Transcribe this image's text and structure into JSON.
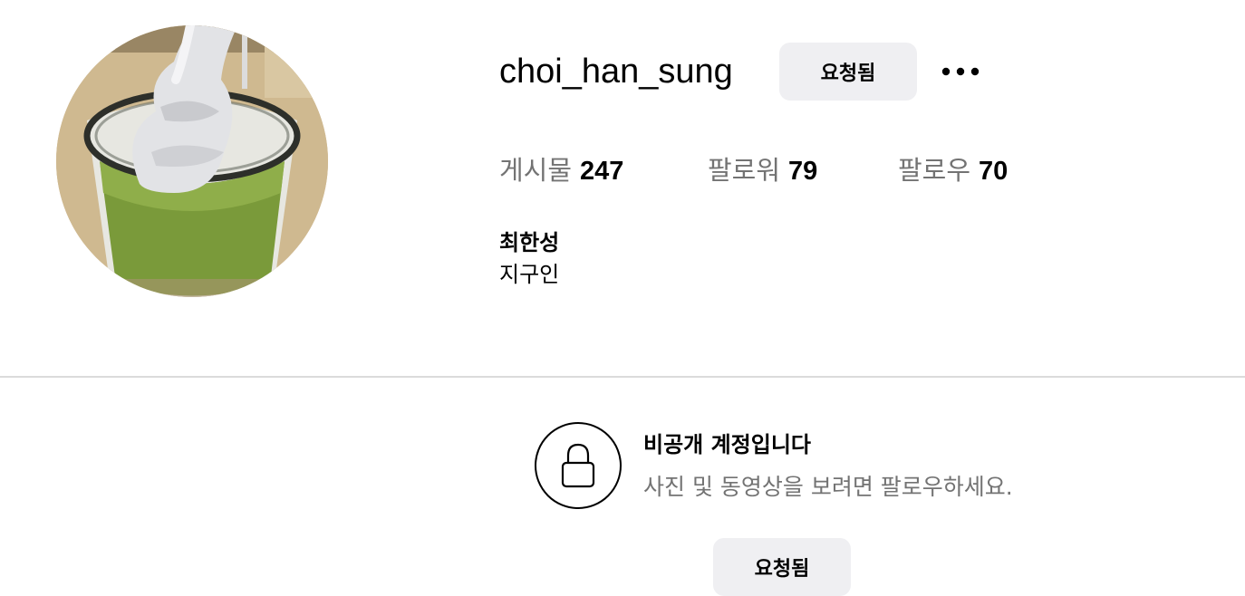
{
  "profile": {
    "username": "choi_han_sung",
    "full_name": "최한성",
    "bio": "지구인",
    "avatar_icon": "matcha-soft-serve-photo"
  },
  "header": {
    "requested_label": "요청됨",
    "more_icon": "ellipsis-icon"
  },
  "stats": {
    "posts_label": "게시물",
    "posts_count": "247",
    "followers_label": "팔로워",
    "followers_count": "79",
    "following_label": "팔로우",
    "following_count": "70"
  },
  "private_notice": {
    "lock_icon": "lock-icon",
    "title": "비공개 계정입니다",
    "subtitle": "사진 및 동영상을 보려면 팔로우하세요.",
    "requested_label": "요청됨"
  },
  "colors": {
    "button_bg": "#efeff2",
    "secondary_text": "#737373",
    "divider": "#dbdbdb"
  }
}
